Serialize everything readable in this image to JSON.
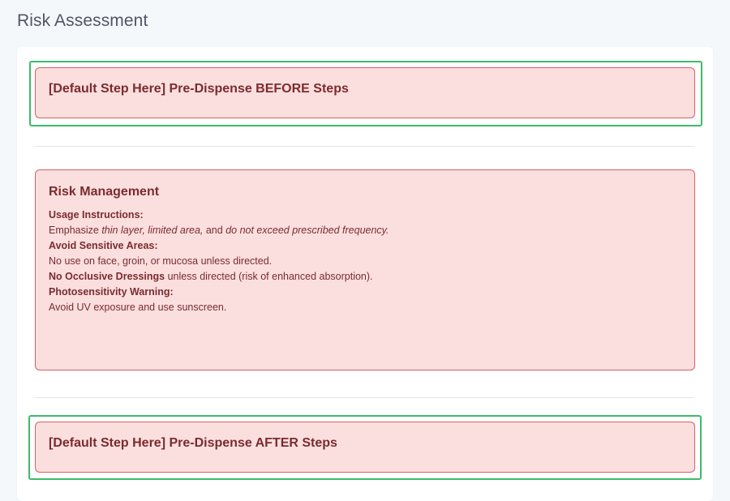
{
  "page": {
    "title": "Risk Assessment"
  },
  "steps": {
    "before_title": "[Default Step Here] Pre-Dispense BEFORE Steps",
    "after_title": "[Default Step Here] Pre-Dispense AFTER Steps"
  },
  "risk_management": {
    "title": "Risk Management",
    "usage_heading": "Usage Instructions:",
    "usage_prefix": "Emphasize ",
    "usage_emph1": "thin layer, limited area,",
    "usage_mid": " and ",
    "usage_emph2": "do not exceed prescribed frequency.",
    "sensitive_heading": "Avoid Sensitive Areas:",
    "sensitive_text": "No use on face, groin, or mucosa unless directed.",
    "occlusive_bold": "No Occlusive Dressings",
    "occlusive_text": " unless directed (risk of enhanced absorption).",
    "photo_heading": "Photosensitivity Warning:",
    "photo_text": "Avoid UV exposure and use sunscreen."
  },
  "colors": {
    "alert_background": "#fbdfdf",
    "alert_border": "#d56166",
    "alert_text": "#7b2b2e",
    "step_outline": "#3dbb6a",
    "page_background": "#f5f8fb"
  }
}
